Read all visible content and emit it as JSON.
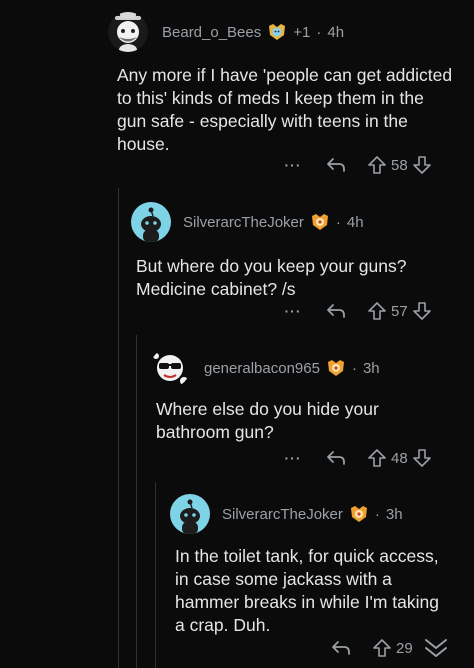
{
  "comments": [
    {
      "username": "Beard_o_Bees",
      "award_count": "+1",
      "separator": "·",
      "time": "4h",
      "body": "Any more if I have 'people can get addicted to this' kinds of meds I keep them in the gun safe - especially with teens in the house.",
      "more": "···",
      "score": "58"
    },
    {
      "username": "SilverarcTheJoker",
      "separator": "·",
      "time": "4h",
      "body": "But where do you keep your guns? Medicine cabinet? /s",
      "more": "···",
      "score": "57"
    },
    {
      "username": "generalbacon965",
      "separator": "·",
      "time": "3h",
      "body": "Where else do you hide your bathroom gun?",
      "more": "···",
      "score": "48"
    },
    {
      "username": "SilverarcTheJoker",
      "separator": "·",
      "time": "3h",
      "body": "In the toilet tank, for quick access, in case some jackass with a hammer breaks in while I'm taking a crap. Duh.",
      "more": "···",
      "score": "29"
    }
  ],
  "colors": {
    "background": "#0b0b0b",
    "text": "#e4e6e8",
    "muted": "#9aa0a6",
    "thread_line": "#2f3133",
    "avatar_teal": "#7ed4e6",
    "award_orange": "#f0a030"
  }
}
